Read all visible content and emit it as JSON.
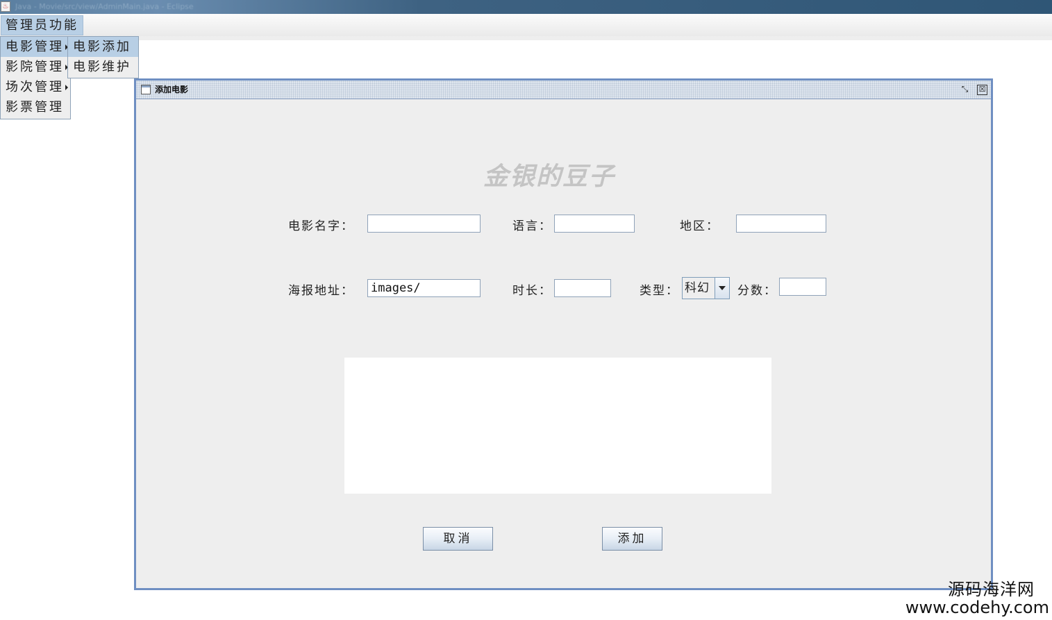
{
  "app": {
    "icon_glyph": "♨",
    "title": "Java - Movie/src/view/AdminMain.java - Eclipse"
  },
  "menubar": {
    "items": [
      {
        "label": "管理员功能"
      }
    ]
  },
  "admin_menu": {
    "items": [
      {
        "label": "电影管理",
        "has_submenu": true,
        "selected": true
      },
      {
        "label": "影院管理",
        "has_submenu": true,
        "selected": false
      },
      {
        "label": "场次管理",
        "has_submenu": true,
        "selected": false
      },
      {
        "label": "影票管理",
        "has_submenu": false,
        "selected": false
      }
    ]
  },
  "movie_submenu": {
    "items": [
      {
        "label": "电影添加",
        "selected": true
      },
      {
        "label": "电影维护",
        "selected": false
      }
    ]
  },
  "dialog": {
    "title": "添加电影",
    "restore_glyph": "⤡",
    "close_glyph": "☒",
    "banner": "金银的豆子",
    "form": {
      "name_label": "电影名字：",
      "name_value": "",
      "language_label": "语言：",
      "language_value": "",
      "region_label": "地区：",
      "region_value": "",
      "poster_label": "海报地址：",
      "poster_value": "images/",
      "duration_label": "时长：",
      "duration_value": "",
      "type_label": "类型：",
      "type_value": "科幻",
      "score_label": "分数：",
      "score_value": "",
      "description_value": ""
    },
    "buttons": {
      "cancel": "取消",
      "add": "添加"
    }
  },
  "watermark": {
    "site_name": "源码海洋网",
    "url": "www.codehy.com"
  },
  "colors": {
    "menu_selected": "#b8cfe5",
    "frame_border": "#6f8fc2",
    "panel_bg": "#eeeeee",
    "banner_text": "#c4c4c4"
  }
}
